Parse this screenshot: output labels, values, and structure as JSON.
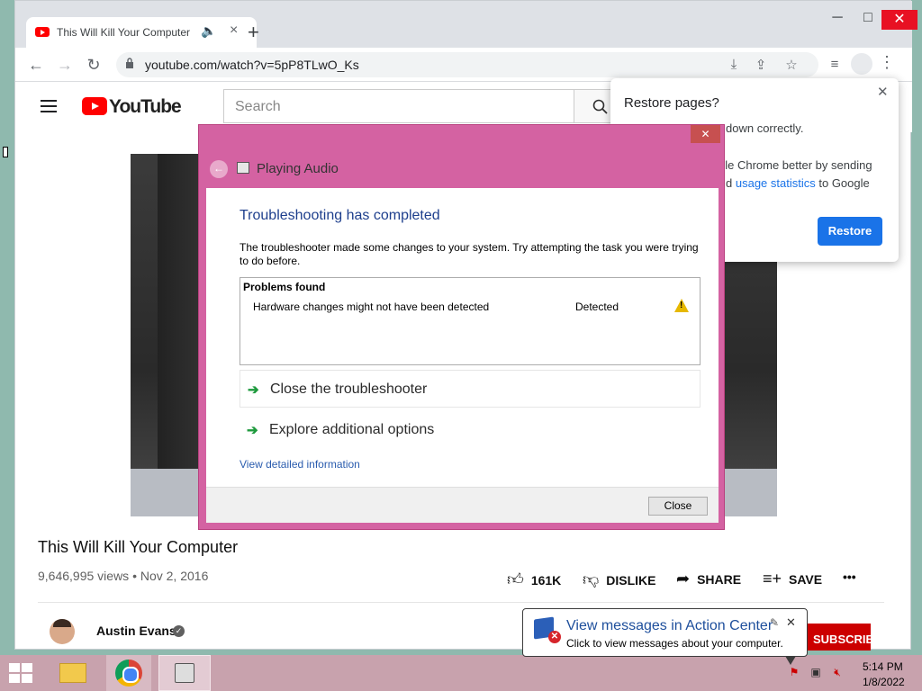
{
  "browser": {
    "tab_title": "This Will Kill Your Computer",
    "tab_audio_icon": "speaker-icon",
    "new_tab": "+",
    "url": "youtube.com/watch?v=5pP8TLwO_Ks"
  },
  "youtube": {
    "logo_text": "YouTube",
    "search_placeholder": "Search",
    "video_title": "This Will Kill Your Computer",
    "views_date": "9,646,995 views • Nov 2, 2016",
    "likes": "161K",
    "dislike_label": "DISLIKE",
    "share_label": "SHARE",
    "save_label": "SAVE",
    "more": "•••",
    "channel_name": "Austin Evans",
    "subscribe_label": "SUBSCRIBE"
  },
  "restore_bubble": {
    "title": "Restore pages?",
    "line1": "down correctly.",
    "line2": "gle Chrome better by sending",
    "line3_prefix": "d",
    "line3_link": "usage statistics",
    "line3_suffix": "to Google",
    "button": "Restore"
  },
  "dialog": {
    "title": "Playing Audio",
    "heading": "Troubleshooting has completed",
    "description": "The troubleshooter made some changes to your system. Try attempting the task you were trying to do before.",
    "problems_header": "Problems found",
    "problems": [
      {
        "name": "Hardware changes might not have been detected",
        "status": "Detected"
      }
    ],
    "options": [
      "Close the troubleshooter",
      "Explore additional options"
    ],
    "details_link": "View detailed information",
    "close_button": "Close"
  },
  "taskbar": {
    "time": "5:14 PM",
    "date": "1/8/2022"
  },
  "balloon": {
    "title": "View messages in Action Center",
    "text": "Click to view messages about your computer."
  },
  "colors": {
    "dialog_frame": "#d462a2",
    "taskbar": "#c8a2ad",
    "chrome_accent": "#1a73e8",
    "youtube_red": "#ff0000"
  }
}
